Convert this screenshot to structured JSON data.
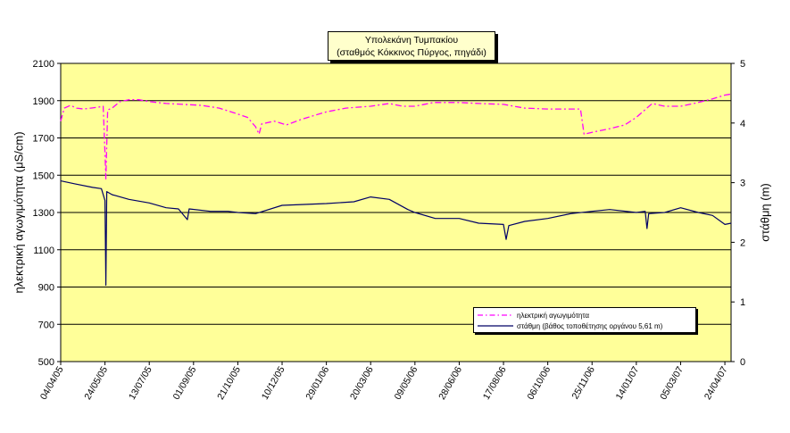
{
  "chart_data": {
    "type": "line",
    "title": "Υπολεκάνη Τυμπακίου",
    "subtitle": "(σταθμός Κόκκινος Πύργος, πηγάδι)",
    "ylabel_left": "ηλεκτρική αγωγιμότητα (μS/cm)",
    "ylabel_right": "στάθμη (m)",
    "ylim_left": [
      500,
      2100
    ],
    "ylim_right": [
      0,
      5
    ],
    "yticks_left": [
      500,
      700,
      900,
      1100,
      1300,
      1500,
      1700,
      1900,
      2100
    ],
    "yticks_right": [
      0,
      1,
      2,
      3,
      4,
      5
    ],
    "x_range": [
      "2005-04-04",
      "2007-05-01"
    ],
    "xtick_labels": [
      "04/04/05",
      "24/05/05",
      "13/07/05",
      "01/09/05",
      "21/10/05",
      "10/12/05",
      "29/01/06",
      "20/03/06",
      "09/05/06",
      "28/06/06",
      "17/08/06",
      "06/10/06",
      "25/11/06",
      "14/01/07",
      "05/03/07",
      "24/04/07"
    ],
    "xtick_dates": [
      "2005-04-04",
      "2005-05-24",
      "2005-07-13",
      "2005-09-01",
      "2005-10-21",
      "2005-12-10",
      "2006-01-29",
      "2006-03-20",
      "2006-05-09",
      "2006-06-28",
      "2006-08-17",
      "2006-10-06",
      "2006-11-25",
      "2007-01-14",
      "2007-03-05",
      "2007-04-24"
    ],
    "grid": "horizontal",
    "legend_position": "bottom-right",
    "series": [
      {
        "name": "ηλεκτρική αγωγιμότητα",
        "axis": "left",
        "color": "#ff00ff",
        "style": "dash-dot",
        "points": [
          [
            "2005-04-04",
            1790
          ],
          [
            "2005-04-08",
            1860
          ],
          [
            "2005-04-15",
            1875
          ],
          [
            "2005-04-22",
            1860
          ],
          [
            "2005-04-30",
            1855
          ],
          [
            "2005-05-08",
            1860
          ],
          [
            "2005-05-16",
            1865
          ],
          [
            "2005-05-22",
            1870
          ],
          [
            "2005-05-24",
            1620
          ],
          [
            "2005-05-25",
            1480
          ],
          [
            "2005-05-27",
            1850
          ],
          [
            "2005-06-01",
            1860
          ],
          [
            "2005-06-10",
            1895
          ],
          [
            "2005-06-20",
            1905
          ],
          [
            "2005-07-01",
            1905
          ],
          [
            "2005-07-13",
            1895
          ],
          [
            "2005-08-01",
            1885
          ],
          [
            "2005-08-20",
            1880
          ],
          [
            "2005-09-10",
            1875
          ],
          [
            "2005-09-30",
            1860
          ],
          [
            "2005-10-20",
            1830
          ],
          [
            "2005-11-01",
            1810
          ],
          [
            "2005-11-10",
            1760
          ],
          [
            "2005-11-14",
            1720
          ],
          [
            "2005-11-17",
            1775
          ],
          [
            "2005-12-01",
            1790
          ],
          [
            "2005-12-15",
            1770
          ],
          [
            "2006-01-01",
            1800
          ],
          [
            "2006-01-29",
            1840
          ],
          [
            "2006-02-20",
            1860
          ],
          [
            "2006-03-20",
            1870
          ],
          [
            "2006-04-10",
            1885
          ],
          [
            "2006-04-25",
            1870
          ],
          [
            "2006-05-09",
            1870
          ],
          [
            "2006-05-30",
            1890
          ],
          [
            "2006-06-28",
            1890
          ],
          [
            "2006-07-20",
            1885
          ],
          [
            "2006-08-17",
            1880
          ],
          [
            "2006-09-10",
            1860
          ],
          [
            "2006-10-06",
            1855
          ],
          [
            "2006-11-01",
            1855
          ],
          [
            "2006-11-12",
            1855
          ],
          [
            "2006-11-16",
            1720
          ],
          [
            "2006-11-25",
            1730
          ],
          [
            "2006-12-15",
            1750
          ],
          [
            "2007-01-01",
            1770
          ],
          [
            "2007-01-14",
            1810
          ],
          [
            "2007-02-01",
            1885
          ],
          [
            "2007-02-15",
            1870
          ],
          [
            "2007-03-05",
            1870
          ],
          [
            "2007-03-25",
            1890
          ],
          [
            "2007-04-10",
            1910
          ],
          [
            "2007-04-24",
            1930
          ],
          [
            "2007-05-01",
            1935
          ]
        ]
      },
      {
        "name": "στάθμη (βάθος τοποθέτησης οργάνου 5,61 m)",
        "axis": "right",
        "color": "#000066",
        "style": "solid",
        "points": [
          [
            "2005-04-04",
            3.03
          ],
          [
            "2005-04-20",
            2.98
          ],
          [
            "2005-05-10",
            2.92
          ],
          [
            "2005-05-20",
            2.9
          ],
          [
            "2005-05-24",
            2.7
          ],
          [
            "2005-05-25",
            1.28
          ],
          [
            "2005-05-26",
            2.85
          ],
          [
            "2005-06-01",
            2.8
          ],
          [
            "2005-06-20",
            2.72
          ],
          [
            "2005-07-13",
            2.66
          ],
          [
            "2005-08-01",
            2.58
          ],
          [
            "2005-08-15",
            2.56
          ],
          [
            "2005-08-25",
            2.38
          ],
          [
            "2005-08-27",
            2.56
          ],
          [
            "2005-09-20",
            2.52
          ],
          [
            "2005-10-10",
            2.52
          ],
          [
            "2005-10-21",
            2.5
          ],
          [
            "2005-11-10",
            2.48
          ],
          [
            "2005-12-10",
            2.62
          ],
          [
            "2006-01-29",
            2.65
          ],
          [
            "2006-03-01",
            2.68
          ],
          [
            "2006-03-20",
            2.76
          ],
          [
            "2006-04-10",
            2.72
          ],
          [
            "2006-05-01",
            2.55
          ],
          [
            "2006-05-09",
            2.5
          ],
          [
            "2006-06-01",
            2.4
          ],
          [
            "2006-06-28",
            2.4
          ],
          [
            "2006-07-20",
            2.32
          ],
          [
            "2006-08-17",
            2.3
          ],
          [
            "2006-08-20",
            2.05
          ],
          [
            "2006-08-23",
            2.28
          ],
          [
            "2006-09-10",
            2.35
          ],
          [
            "2006-10-06",
            2.4
          ],
          [
            "2006-11-01",
            2.48
          ],
          [
            "2006-11-25",
            2.52
          ],
          [
            "2006-12-15",
            2.55
          ],
          [
            "2007-01-14",
            2.5
          ],
          [
            "2007-01-24",
            2.52
          ],
          [
            "2007-01-26",
            2.23
          ],
          [
            "2007-01-28",
            2.48
          ],
          [
            "2007-02-15",
            2.5
          ],
          [
            "2007-03-05",
            2.58
          ],
          [
            "2007-03-25",
            2.5
          ],
          [
            "2007-04-10",
            2.45
          ],
          [
            "2007-04-24",
            2.3
          ],
          [
            "2007-05-01",
            2.32
          ]
        ]
      }
    ]
  }
}
